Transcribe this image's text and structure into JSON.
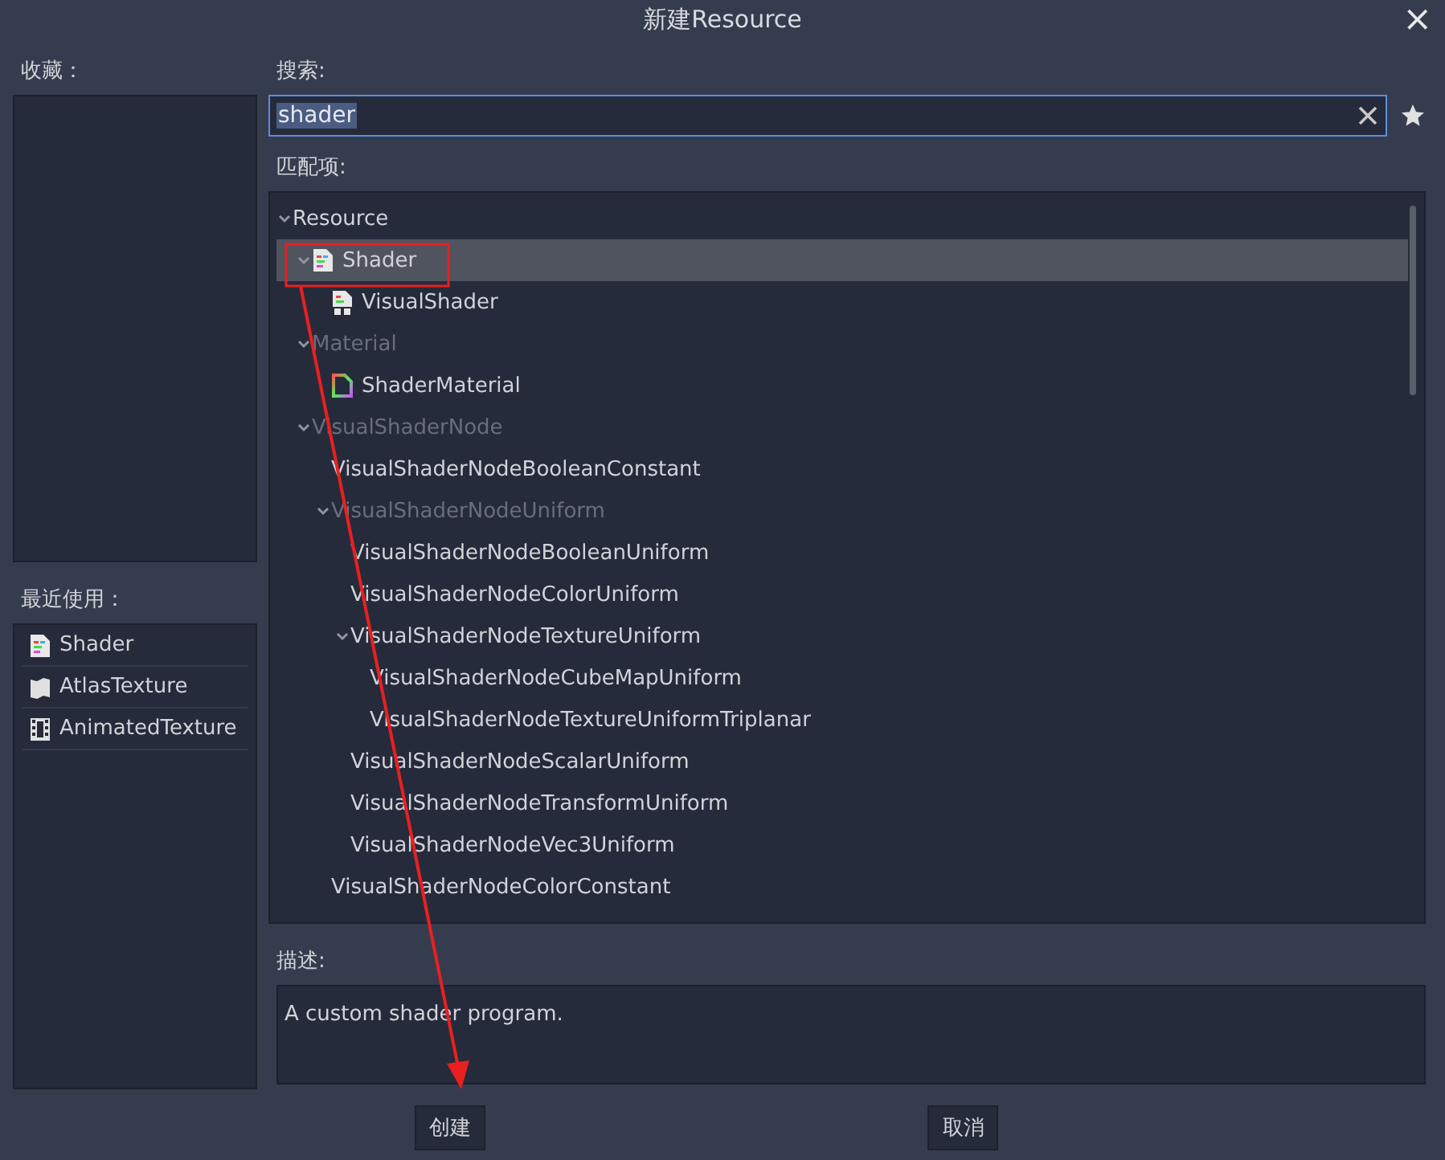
{
  "window": {
    "title": "新建Resource",
    "close": "×"
  },
  "favorites": {
    "label": "收藏："
  },
  "recent": {
    "label": "最近使用：",
    "items": [
      {
        "label": "Shader",
        "kind": "shader"
      },
      {
        "label": "AtlasTexture",
        "kind": "atlas"
      },
      {
        "label": "AnimatedTexture",
        "kind": "animated"
      }
    ]
  },
  "search": {
    "label": "搜索:",
    "value": "shader"
  },
  "matches": {
    "label": "匹配项:",
    "tree": [
      {
        "label": "Resource",
        "disabled": false,
        "selected": false,
        "expanded": true,
        "children": [
          {
            "label": "Shader",
            "kind": "shader",
            "disabled": false,
            "selected": true,
            "expanded": true,
            "children": [
              {
                "label": "VisualShader",
                "kind": "visual-shader",
                "disabled": false,
                "selected": false
              }
            ]
          },
          {
            "label": "Material",
            "disabled": true,
            "selected": false,
            "expanded": true,
            "children": [
              {
                "label": "ShaderMaterial",
                "kind": "material",
                "disabled": false,
                "selected": false
              }
            ]
          },
          {
            "label": "VisualShaderNode",
            "disabled": true,
            "selected": false,
            "expanded": true,
            "children": [
              {
                "label": "VisualShaderNodeBooleanConstant",
                "disabled": false,
                "selected": false
              },
              {
                "label": "VisualShaderNodeUniform",
                "disabled": true,
                "selected": false,
                "expanded": true,
                "children": [
                  {
                    "label": "VisualShaderNodeBooleanUniform",
                    "disabled": false,
                    "selected": false
                  },
                  {
                    "label": "VisualShaderNodeColorUniform",
                    "disabled": false,
                    "selected": false
                  },
                  {
                    "label": "VisualShaderNodeTextureUniform",
                    "disabled": false,
                    "selected": false,
                    "expanded": true,
                    "children": [
                      {
                        "label": "VisualShaderNodeCubeMapUniform",
                        "disabled": false,
                        "selected": false
                      },
                      {
                        "label": "VisualShaderNodeTextureUniformTriplanar",
                        "disabled": false,
                        "selected": false
                      }
                    ]
                  },
                  {
                    "label": "VisualShaderNodeScalarUniform",
                    "disabled": false,
                    "selected": false
                  },
                  {
                    "label": "VisualShaderNodeTransformUniform",
                    "disabled": false,
                    "selected": false
                  },
                  {
                    "label": "VisualShaderNodeVec3Uniform",
                    "disabled": false,
                    "selected": false
                  }
                ]
              },
              {
                "label": "VisualShaderNodeColorConstant",
                "disabled": false,
                "selected": false
              }
            ]
          }
        ]
      }
    ]
  },
  "description": {
    "label": "描述:",
    "text": "A custom shader program."
  },
  "buttons": [
    "创建",
    "取消"
  ]
}
